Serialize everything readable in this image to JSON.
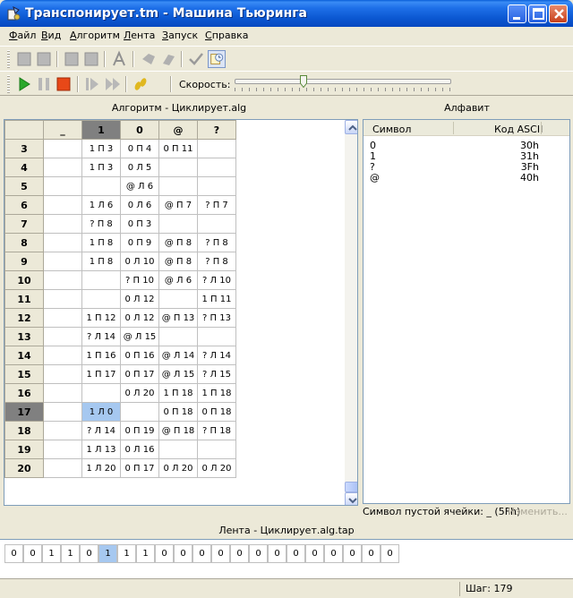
{
  "window": {
    "title": "Транспонирует.tm - Машина Тьюринга"
  },
  "menu": [
    "Файл",
    "Вид",
    "Алгоритм",
    "Лента",
    "Запуск",
    "Справка"
  ],
  "speed": {
    "label": "Скорость:",
    "value_fraction": 0.31
  },
  "algorithm_panel": {
    "title": "Алгоритм - Циклирует.alg",
    "columns": [
      "_",
      "1",
      "0",
      "@",
      "?"
    ],
    "current_column": "1",
    "current_row": "17",
    "rows": [
      {
        "state": "3",
        "cells": [
          "",
          "1 П 3",
          "0 П 4",
          "0 П 11",
          ""
        ]
      },
      {
        "state": "4",
        "cells": [
          "",
          "1 П 3",
          "0 Л 5",
          "",
          ""
        ]
      },
      {
        "state": "5",
        "cells": [
          "",
          "",
          "@ Л 6",
          "",
          ""
        ]
      },
      {
        "state": "6",
        "cells": [
          "",
          "1 Л 6",
          "0 Л 6",
          "@ П 7",
          "? П 7"
        ]
      },
      {
        "state": "7",
        "cells": [
          "",
          "? П 8",
          "0 П 3",
          "",
          ""
        ]
      },
      {
        "state": "8",
        "cells": [
          "",
          "1 П 8",
          "0 П 9",
          "@ П 8",
          "? П 8"
        ]
      },
      {
        "state": "9",
        "cells": [
          "",
          "1 П 8",
          "0 Л 10",
          "@ П 8",
          "? П 8"
        ]
      },
      {
        "state": "10",
        "cells": [
          "",
          "",
          "? П 10",
          "@ Л 6",
          "? Л 10"
        ]
      },
      {
        "state": "11",
        "cells": [
          "",
          "",
          "0 Л 12",
          "",
          "1 П 11"
        ]
      },
      {
        "state": "12",
        "cells": [
          "",
          "1 П 12",
          "0 Л 12",
          "@ П 13",
          "? П 13"
        ]
      },
      {
        "state": "13",
        "cells": [
          "",
          "? Л 14",
          "@ Л 15",
          "",
          ""
        ]
      },
      {
        "state": "14",
        "cells": [
          "",
          "1 П 16",
          "0 П 16",
          "@ Л 14",
          "? Л 14"
        ]
      },
      {
        "state": "15",
        "cells": [
          "",
          "1 П 17",
          "0 П 17",
          "@ Л 15",
          "? Л 15"
        ]
      },
      {
        "state": "16",
        "cells": [
          "",
          "",
          "0 Л 20",
          "1 П 18",
          "1 П 18"
        ]
      },
      {
        "state": "17",
        "cells": [
          "",
          "1 Л 0",
          "",
          "0 П 18",
          "0 П 18"
        ]
      },
      {
        "state": "18",
        "cells": [
          "",
          "? Л 14",
          "0 П 19",
          "@ П 18",
          "? П 18"
        ]
      },
      {
        "state": "19",
        "cells": [
          "",
          "1 Л 13",
          "0 Л 16",
          "",
          ""
        ]
      },
      {
        "state": "20",
        "cells": [
          "",
          "1 Л 20",
          "0 П 17",
          "0 Л 20",
          "0 Л 20"
        ]
      }
    ]
  },
  "alphabet_panel": {
    "title": "Алфавит",
    "col_symbol": "Символ",
    "col_code": "Код ASCII",
    "items": [
      {
        "symbol": "0",
        "code": "30h"
      },
      {
        "symbol": "1",
        "code": "31h"
      },
      {
        "symbol": "?",
        "code": "3Fh"
      },
      {
        "symbol": "@",
        "code": "40h"
      }
    ],
    "blank_symbol": "Символ пустой ячейки: _ (5Fh)",
    "change_label": "Изменить..."
  },
  "tape_panel": {
    "title": "Лента - Циклирует.alg.tap",
    "cells": [
      "0",
      "0",
      "1",
      "1",
      "0",
      "1",
      "1",
      "1",
      "0",
      "0",
      "0",
      "0",
      "0",
      "0",
      "0",
      "0",
      "0",
      "0",
      "0",
      "0",
      "0"
    ],
    "current_index": 5
  },
  "status": {
    "step": "Шаг: 179"
  },
  "colors": {
    "selection": "#a6c8f0",
    "current_header": "#808080",
    "title_bar": "#0a56d0"
  }
}
